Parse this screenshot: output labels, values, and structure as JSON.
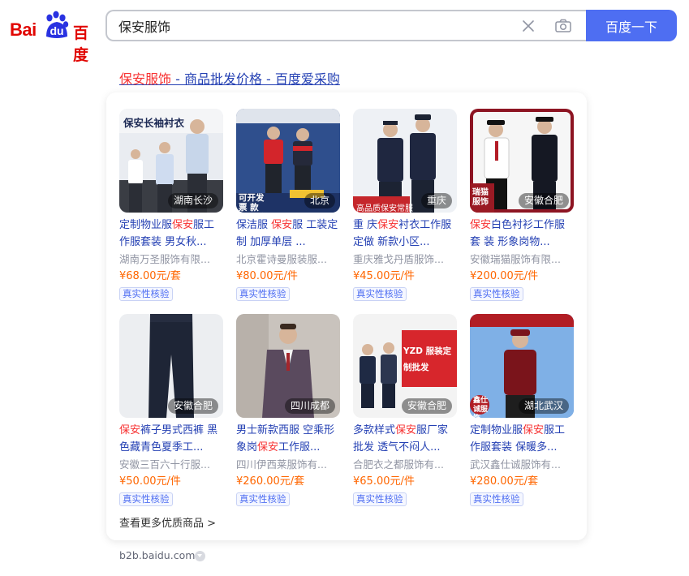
{
  "header": {
    "logo_text_latin": "Bai",
    "logo_text_du": "du",
    "logo_text_cn": "百度",
    "search_value": "保安服饰",
    "search_button": "百度一下"
  },
  "result": {
    "title_highlight": "保安服饰",
    "title_rest": " - 商品批发价格 - 百度爱采购",
    "more_link": "查看更多优质商品 >",
    "source": "b2b.baidu.com"
  },
  "products": [
    {
      "location": "湖南长沙",
      "name_pre": "定制物业服",
      "name_hl": "保安",
      "name_post": "服工作服套装 男女秋...",
      "shop": "湖南万圣服饰有限...",
      "price": "¥68.00元/套",
      "badge": "真实性核验",
      "thumb_text": "保安长袖衬衣"
    },
    {
      "location": "北京",
      "name_pre": "保洁服 ",
      "name_hl": "保安",
      "name_post": "服 工装定制 加厚单层 ...",
      "shop": "北京霍诗曼服装服...",
      "price": "¥80.00元/件",
      "badge": "真实性核验",
      "thumb_text": "可开发票 款式多样"
    },
    {
      "location": "重庆",
      "name_pre": "重 庆",
      "name_hl": "保安",
      "name_post": "衬衣工作服定做 新款小区...",
      "shop": "重庆雅戈丹盾服饰...",
      "price": "¥45.00元/件",
      "badge": "真实性核验",
      "thumb_text": "高品质保安常服"
    },
    {
      "location": "安徽合肥",
      "name_pre": "",
      "name_hl": "保安",
      "name_post": "白色衬衫工作服套 装 形象岗物...",
      "shop": "安徽瑞猫服饰有限...",
      "price": "¥200.00元/件",
      "badge": "真实性核验",
      "thumb_text": "瑞猫服饰"
    },
    {
      "location": "安徽合肥",
      "name_pre": "",
      "name_hl": "保安",
      "name_post": "裤子男式西裤 黑色藏青色夏季工...",
      "shop": "安徽三百六十行服...",
      "price": "¥50.00元/件",
      "badge": "真实性核验",
      "thumb_text": ""
    },
    {
      "location": "四川成都",
      "name_pre": "男士新款西服 空乘形象岗",
      "name_hl": "保安",
      "name_post": "工作服...",
      "shop": "四川伊西莱服饰有...",
      "price": "¥260.00元/套",
      "badge": "真实性核验",
      "thumb_text": ""
    },
    {
      "location": "安徽合肥",
      "name_pre": "多款样式",
      "name_hl": "保安",
      "name_post": "服厂家批发 透气不闷人...",
      "shop": "合肥衣之都服饰有...",
      "price": "¥65.00元/件",
      "badge": "真实性核验",
      "thumb_text": "YZD 服装定制批发"
    },
    {
      "location": "湖北武汉",
      "name_pre": "定制物业服",
      "name_hl": "保安",
      "name_post": "服工作服套装 保暖多...",
      "shop": "武汉鑫仕诚服饰有...",
      "price": "¥280.00元/套",
      "badge": "真实性核验",
      "thumb_text": "鑫仕诚服饰 厂家直销"
    }
  ],
  "colors": {
    "brand_blue": "#4e6ef2",
    "link_blue": "#2440b3",
    "highlight_red": "#f73131",
    "price_orange": "#ff6600",
    "logo_red": "#e10602"
  }
}
